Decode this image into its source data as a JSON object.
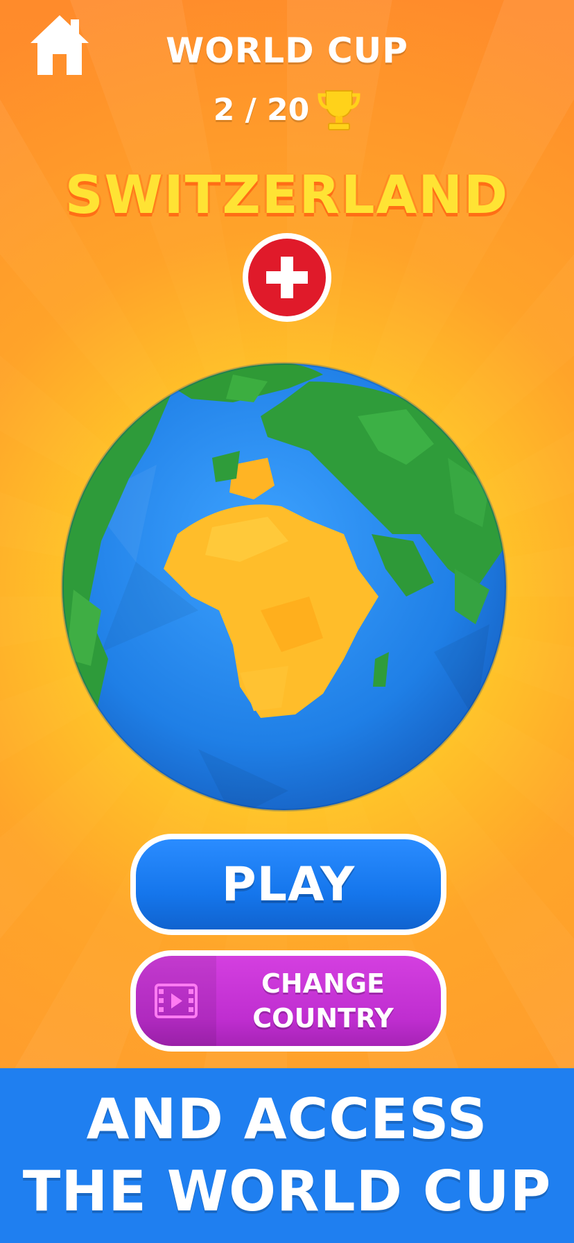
{
  "header": {
    "title": "WORLD CUP",
    "progress": "2 / 20",
    "home_icon": "home-icon",
    "trophy_icon": "trophy-icon"
  },
  "country": {
    "name": "SWITZERLAND",
    "flag_icon": "switzerland-flag-icon"
  },
  "globe": {
    "icon": "low-poly-globe"
  },
  "buttons": {
    "play_label": "PLAY",
    "change_label": "CHANGE\nCOUNTRY",
    "change_icon": "video-icon"
  },
  "banner": {
    "text": "AND ACCESS\nTHE WORLD CUP"
  },
  "colors": {
    "background": "#ff8c2e",
    "country_text": "#ffe334",
    "play_button": "#1576ec",
    "change_button": "#bf2ed0",
    "banner": "#1f7ff0"
  }
}
